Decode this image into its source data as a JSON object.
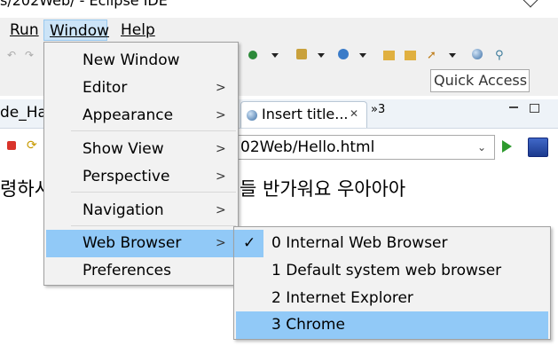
{
  "window": {
    "title": "s/202Web/ - Eclipse IDE"
  },
  "menubar": {
    "run": "Run",
    "window": "Window",
    "help": "Help"
  },
  "quick_access": {
    "placeholder": "Quick Access"
  },
  "tabs": {
    "left_partial": "de_Ha",
    "active": "Insert title...",
    "overflow": "»3"
  },
  "url_bar": {
    "value": "02Web/Hello.html"
  },
  "page": {
    "left_text": "령하시",
    "right_text": "들 반가워요 우아아아"
  },
  "window_menu": {
    "items": [
      {
        "label": "New Window",
        "submenu": false
      },
      {
        "label": "Editor",
        "submenu": true
      },
      {
        "label": "Appearance",
        "submenu": true
      },
      {
        "label": "Show View",
        "submenu": true
      },
      {
        "label": "Perspective",
        "submenu": true
      },
      {
        "label": "Navigation",
        "submenu": true
      },
      {
        "label": "Web Browser",
        "submenu": true,
        "highlighted": true
      },
      {
        "label": "Preferences",
        "submenu": false
      }
    ]
  },
  "web_browser_submenu": {
    "items": [
      {
        "label": "0 Internal Web Browser",
        "checked": true
      },
      {
        "label": "1 Default system web browser",
        "checked": false
      },
      {
        "label": "2 Internet Explorer",
        "checked": false
      },
      {
        "label": "3 Chrome",
        "checked": false,
        "highlighted": true
      }
    ]
  },
  "colors": {
    "highlight": "#91c9f7",
    "menu_bg": "#f2f2f2",
    "chrome_bg": "#f0f0f0"
  }
}
